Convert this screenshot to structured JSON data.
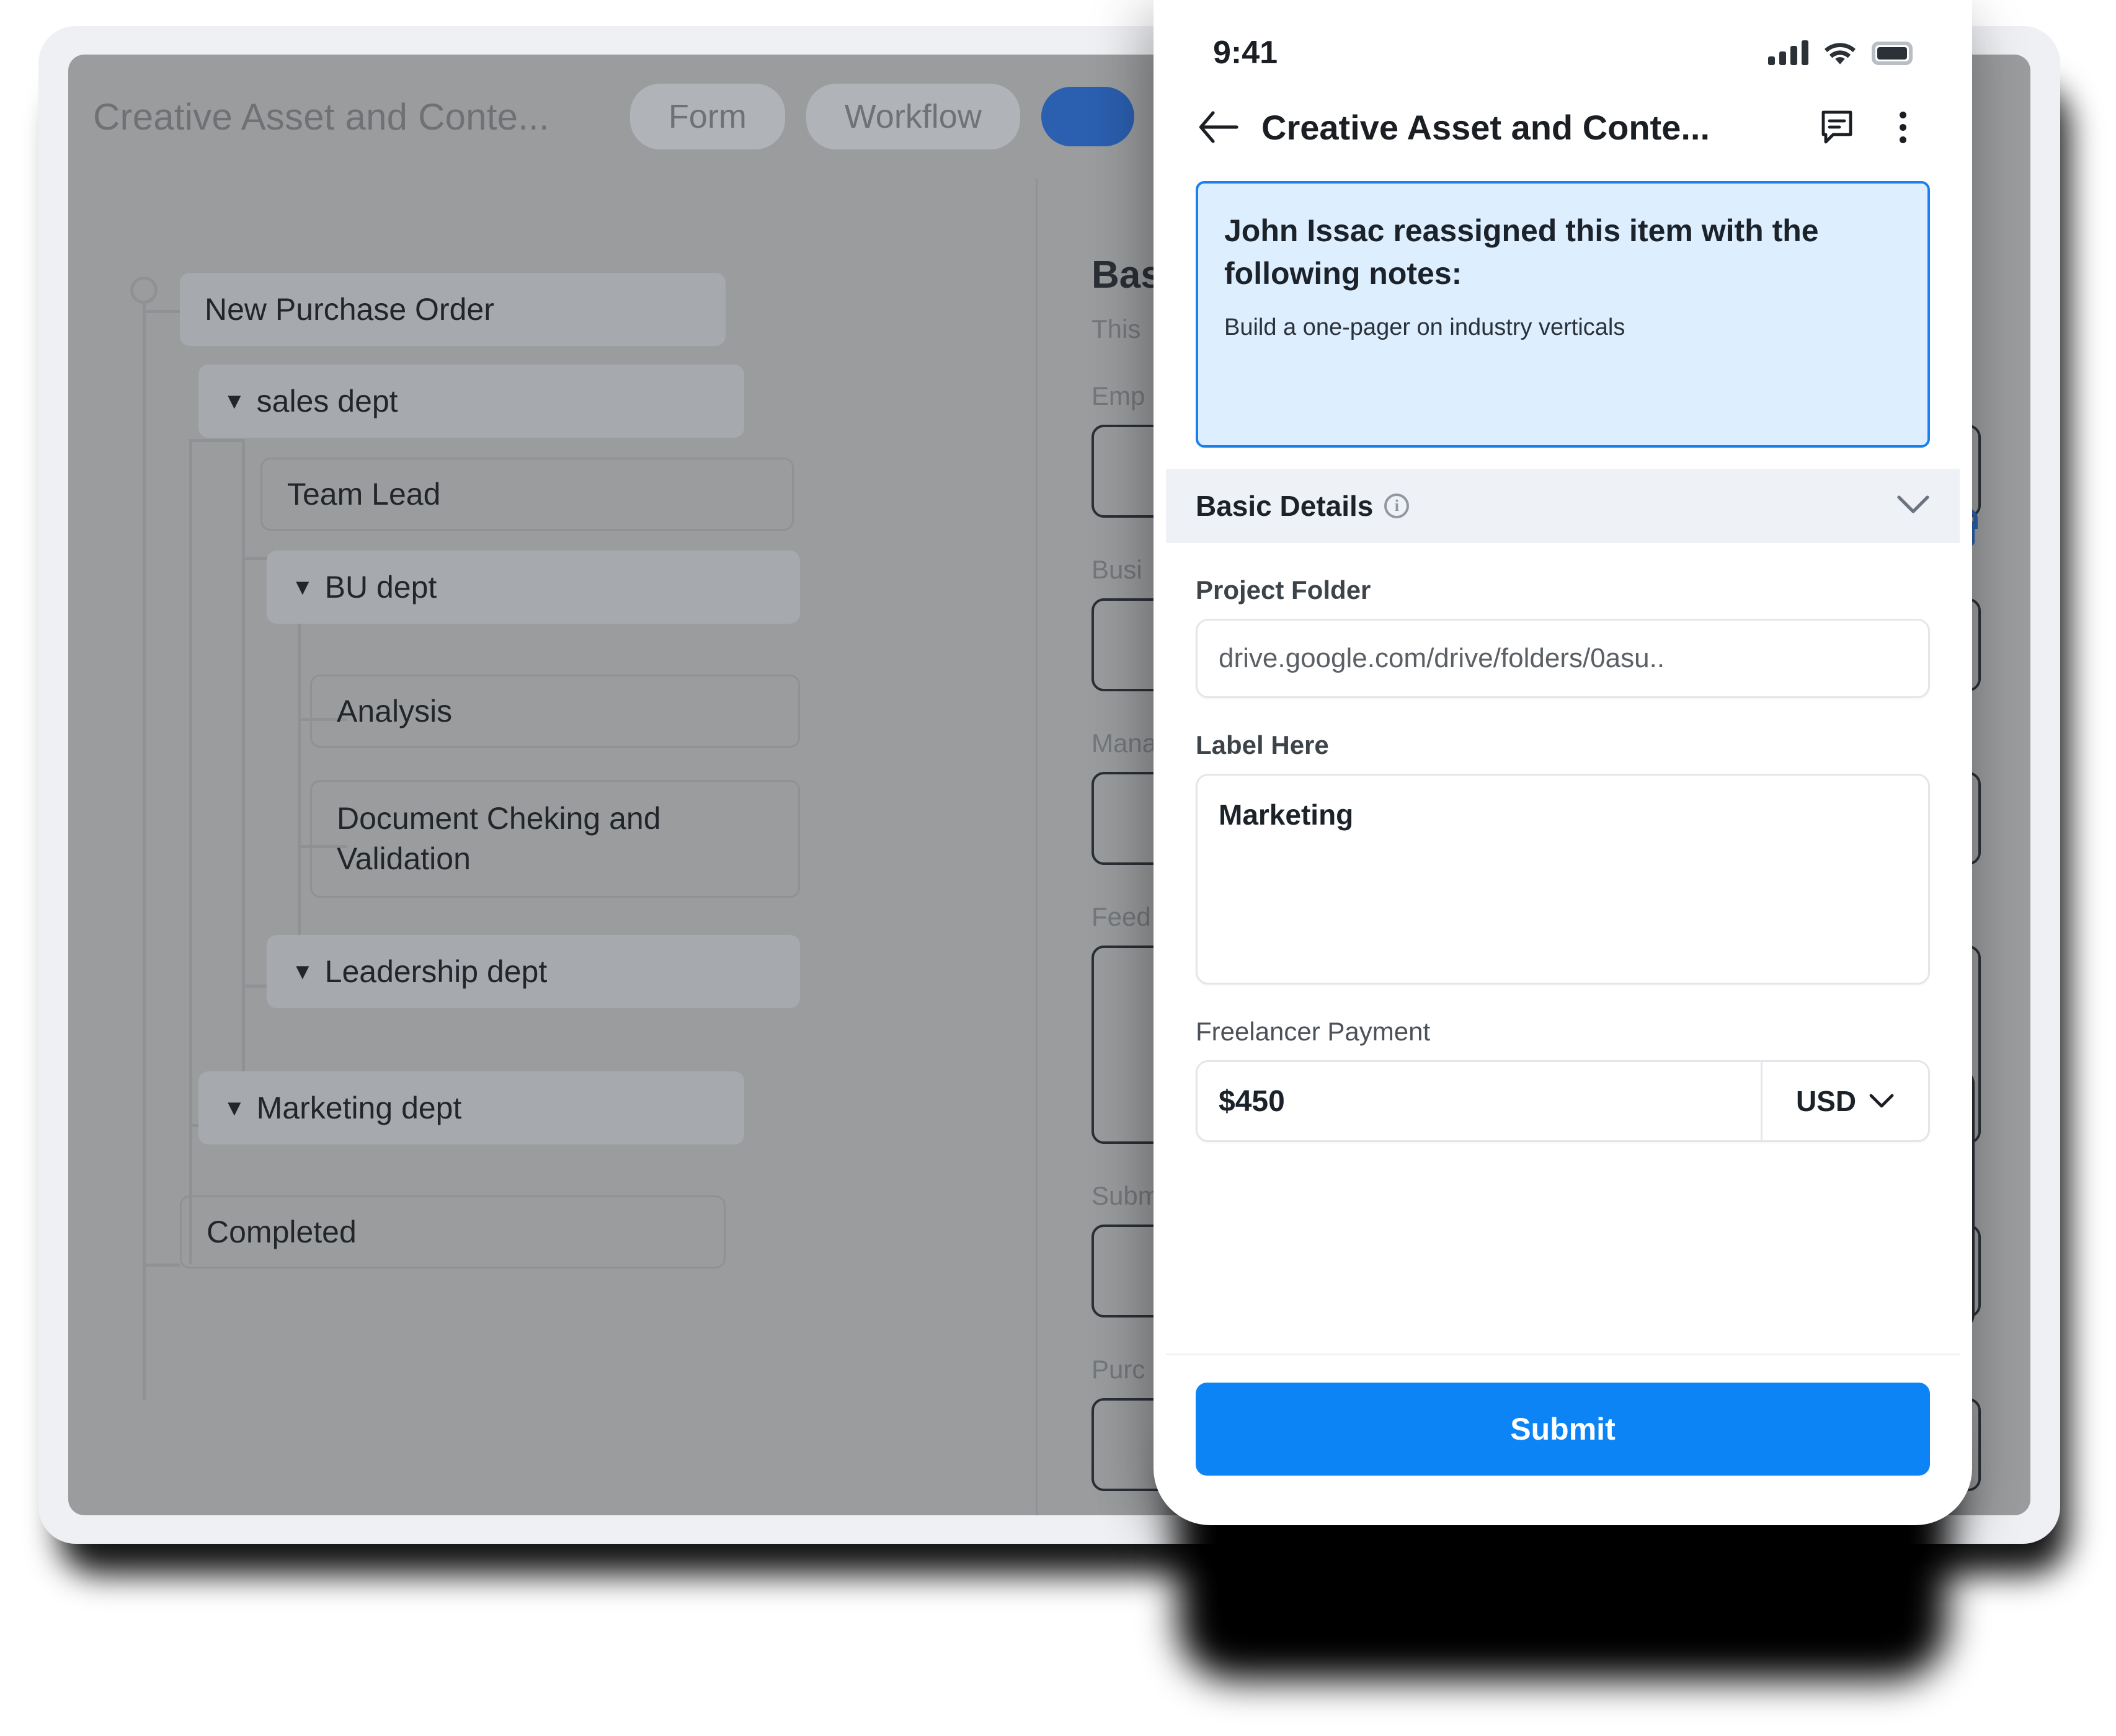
{
  "tablet": {
    "header": {
      "title": "Creative Asset and Conte...",
      "tabs": [
        {
          "label": "Form"
        },
        {
          "label": "Workflow"
        },
        {
          "label": ""
        }
      ],
      "close_icon": "close-icon"
    },
    "tree": {
      "nodes": [
        {
          "label": "New Purchase Order",
          "style": "filled",
          "caret": ""
        },
        {
          "label": "sales dept",
          "style": "filled",
          "caret": "▼"
        },
        {
          "label": "Team Lead",
          "style": "outline",
          "caret": ""
        },
        {
          "label": "BU dept",
          "style": "filled",
          "caret": "▼"
        },
        {
          "label": "Analysis",
          "style": "outline",
          "caret": ""
        },
        {
          "label": "Document Cheking and Validation",
          "style": "outline",
          "caret": ""
        },
        {
          "label": "Leadership dept",
          "style": "filled",
          "caret": "▼"
        },
        {
          "label": "Marketing dept",
          "style": "filled",
          "caret": "▼"
        },
        {
          "label": "Completed",
          "style": "outline",
          "caret": ""
        }
      ]
    },
    "form_pane": {
      "title": "Bas",
      "subtitle": "This",
      "labels": [
        "Emp",
        "Busi",
        "Mana",
        "Feed",
        "Subm",
        "Purc"
      ]
    }
  },
  "phone": {
    "status_bar": {
      "time": "9:41",
      "signal_icon": "cellular-signal-icon",
      "wifi_icon": "wifi-icon",
      "battery_icon": "battery-icon"
    },
    "nav": {
      "back_icon": "back-arrow-icon",
      "title": "Creative Asset and Conte...",
      "comment_icon": "comment-icon",
      "more_icon": "kebab-menu-icon"
    },
    "notice": {
      "title": "John Issac reassigned this item with the following notes:",
      "body": "Build a one-pager on industry verticals",
      "border_color": "#1a80f0",
      "background_color": "#ddeeff"
    },
    "section": {
      "title": "Basic Details",
      "info_icon": "info-icon",
      "collapse_icon": "chevron-down-icon"
    },
    "fields": {
      "project_folder": {
        "label": "Project Folder",
        "value": "drive.google.com/drive/folders/0asu.."
      },
      "label_here": {
        "label": "Label Here",
        "value": "Marketing"
      },
      "freelancer_payment": {
        "label": "Freelancer Payment",
        "amount": "$450",
        "currency": "USD",
        "currency_chevron_icon": "chevron-down-icon"
      }
    },
    "footer": {
      "submit_label": "Submit",
      "submit_color": "#0c84f5"
    }
  }
}
